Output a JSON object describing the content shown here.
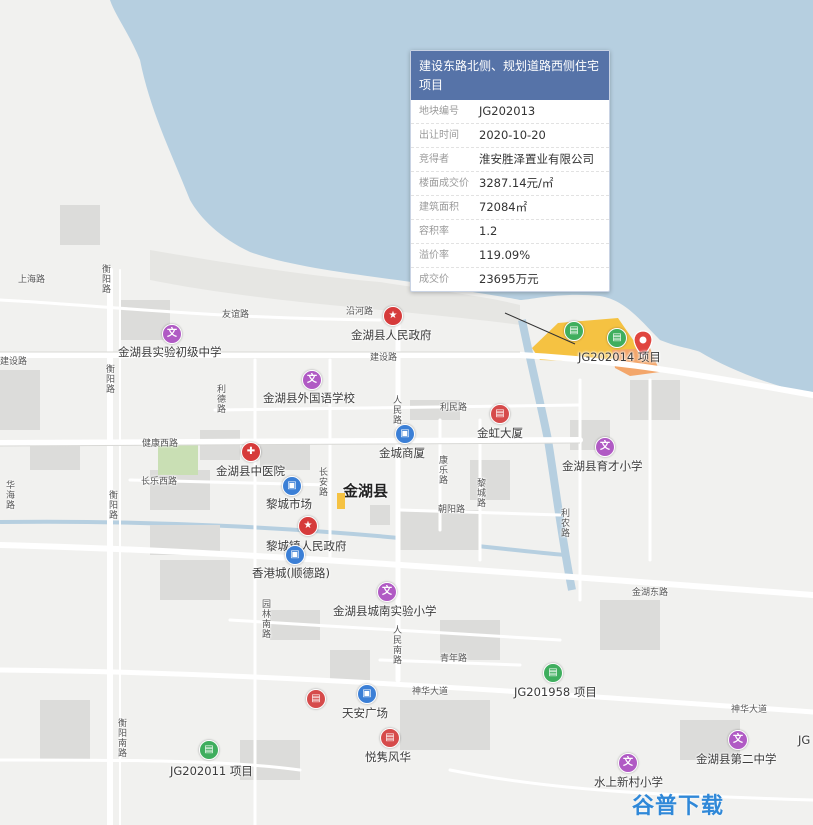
{
  "popup": {
    "title": "建设东路北侧、规划道路西侧住宅项目",
    "rows": [
      {
        "key": "地块编号",
        "value": "JG202013"
      },
      {
        "key": "出让时间",
        "value": "2020-10-20"
      },
      {
        "key": "竞得者",
        "value": "淮安胜泽置业有限公司"
      },
      {
        "key": "楼面成交价",
        "value": "3287.14元/㎡"
      },
      {
        "key": "建筑面积",
        "value": "72084㎡"
      },
      {
        "key": "容积率",
        "value": "1.2"
      },
      {
        "key": "溢价率",
        "value": "119.09%"
      },
      {
        "key": "成交价",
        "value": "23695万元"
      }
    ]
  },
  "pois": {
    "gov_county": "金湖县人民政府",
    "school_shiyan_mid": "金湖县实验初级中学",
    "school_foreign": "金湖县外国语学校",
    "hospital": "金湖县中医院",
    "jincheng": "金城商厦",
    "jinhong": "金虹大厦",
    "licheng_market": "黎城市场",
    "gov_licheng": "黎城镇人民政府",
    "hongkong_city": "香港城(顺德路)",
    "school_chengnan": "金湖县城南实验小学",
    "school_yucai": "金湖县育才小学",
    "tianan": "天安广场",
    "yuejun": "悦隽风华",
    "school_shuishang": "水上新村小学",
    "school_second_mid": "金湖县第二中学",
    "county_name": "金湖县",
    "project_2014": "JG202014 项目",
    "project_1958": "JG201958 项目",
    "project_2011": "JG202011 项目",
    "edge_label": "JG"
  },
  "roads": {
    "shanghai": "上海路",
    "youyi": "友谊路",
    "yanhe": "沿河路",
    "jianshe": "建设路",
    "jianshe_left": "建设路",
    "weiyang1": "衡阳路",
    "weiyang2": "衡阳路",
    "weiyang3": "衡阳路",
    "weiyang4": "衡阳南路",
    "lide": "利德路",
    "renmin1": "人民路",
    "renmin2": "人民南路",
    "limin": "利民路",
    "jiankang": "健康西路",
    "changle": "长乐西路",
    "huahai": "华海路",
    "changan": "长安路",
    "kangle": "康乐路",
    "yicheng": "黎城路",
    "chaoyang": "朝阳路",
    "linong": "利农路",
    "jinhu_east": "金湖东路",
    "yuanlin": "园林南路",
    "qingnian": "青年路",
    "shenhua": "神华大道",
    "shenhua_east": "神华大道"
  },
  "watermark": {
    "text": "谷普下载"
  },
  "colors": {
    "water": "#b6cfe0",
    "background": "#f1f1ef",
    "block": "#dcdcda",
    "park": "#c9dfb4",
    "land_plot": "#f5c242",
    "land_plot2": "#f3a66a",
    "popup_header": "#5673a8",
    "marker_red": "#e0463f"
  }
}
